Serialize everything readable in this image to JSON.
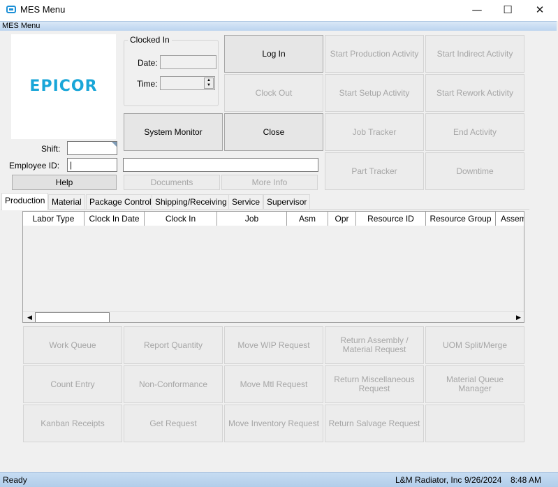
{
  "window": {
    "title": "MES Menu",
    "minimize": "—",
    "maximize": "☐",
    "close": "✕"
  },
  "menubar": {
    "label": "MES Menu"
  },
  "logo": {
    "text": "EPICOR"
  },
  "form": {
    "shift_label": "Shift:",
    "shift_value": "",
    "employee_label": "Employee ID:",
    "employee_value": "|",
    "employee_name": "",
    "help": "Help",
    "clocked_in_title": "Clocked In",
    "date_label": "Date:",
    "time_label": "Time:"
  },
  "buttons": {
    "log_in": "Log In",
    "clock_out": "Clock Out",
    "system_monitor": "System Monitor",
    "close": "Close",
    "start_production": "Start Production Activity",
    "start_indirect": "Start Indirect Activity",
    "start_setup": "Start Setup Activity",
    "start_rework": "Start Rework Activity",
    "job_tracker": "Job Tracker",
    "end_activity": "End Activity",
    "part_tracker": "Part Tracker",
    "downtime": "Downtime",
    "documents": "Documents",
    "more_info": "More Info"
  },
  "tabs": [
    "Production",
    "Material",
    "Package Control",
    "Shipping/Receiving",
    "Service",
    "Supervisor"
  ],
  "grid": {
    "columns": [
      "Labor Type",
      "Clock In Date",
      "Clock In",
      "Job",
      "Asm",
      "Opr",
      "Resource ID",
      "Resource Group",
      "Assem"
    ]
  },
  "bottom_buttons": {
    "work_queue": "Work Queue",
    "report_quantity": "Report Quantity",
    "move_wip": "Move WIP Request",
    "return_assembly": "Return Assembly / Material Request",
    "uom_split": "UOM Split/Merge",
    "count_entry": "Count Entry",
    "non_conformance": "Non-Conformance",
    "move_mtl": "Move Mtl Request",
    "return_misc": "Return Miscellaneous Request",
    "material_queue": "Material Queue Manager",
    "kanban": "Kanban Receipts",
    "get_request": "Get Request",
    "move_inventory": "Move Inventory Request",
    "return_salvage": "Return Salvage Request"
  },
  "status": {
    "text": "Ready",
    "company": "L&M Radiator, Inc",
    "date": "9/26/2024",
    "time": "8:48 AM"
  },
  "colors": {
    "accent": "#19a6d8",
    "status_bar": "#b9d3ee"
  }
}
